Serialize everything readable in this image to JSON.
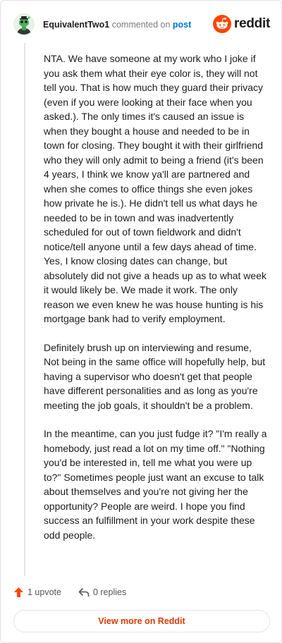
{
  "comment": {
    "author": "EquivalentTwo1",
    "action_text": "commented on",
    "post_link": "post",
    "brand": "reddit",
    "paragraphs": [
      "NTA. We have someone at my work who I joke if you ask them what their eye color is, they will not tell you. That is how much they guard their privacy (even if you were looking at their face when you asked.). The only times it's caused an issue is when they bought a house and needed to be in town for closing. They bought it with their girlfriend who they will only admit to being a friend (it's been 4 years, I think we know ya'll are partnered and when she comes to office things she even jokes how private he is.). He didn't tell us what days he needed to be in town and was inadvertently scheduled for out of town fieldwork and didn't notice/tell anyone until a few days ahead of time. Yes, I know closing dates can change, but absolutely did not give a heads up as to what week it would likely be. We made it work. The only reason we even knew he was house hunting is his mortgage bank had to verify employment.",
      "Definitely brush up on interviewing and resume, Not being in the same office will hopefully help, but having a supervisor who doesn't get that people have different personalities and as long as you're meeting the job goals, it shouldn't be a problem.",
      "In the meantime, can you just fudge it? \"I'm really a homebody, just read a lot on my time off.\" \"Nothing you'd be interested in, tell me what you were up to?\" Sometimes people just want an excuse to talk about themselves and you're not giving her the opportunity? People are weird. I hope you find success an fulfillment in your work despite these odd people."
    ],
    "upvotes_label": "1 upvote",
    "replies_label": "0 replies",
    "view_more_label": "View more on Reddit"
  },
  "colors": {
    "upvote": "#ff4500",
    "link": "#0079d3",
    "view_more": "#d93a00",
    "brand_orange": "#ff4500"
  },
  "icons": {
    "avatar": "snoo-avatar",
    "logo": "reddit-logo-icon",
    "upvote": "upvote-arrow-icon",
    "reply": "reply-arrow-icon"
  }
}
